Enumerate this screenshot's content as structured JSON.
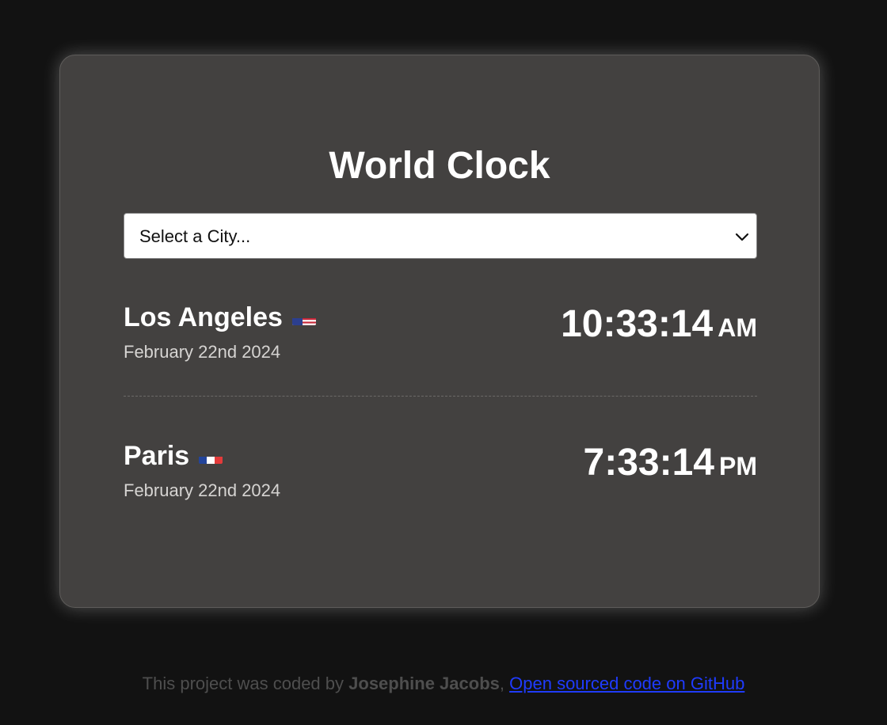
{
  "app": {
    "title": "World Clock"
  },
  "city_select": {
    "selected_label": "Select a City...",
    "icon": "chevron-down-icon"
  },
  "cities": [
    {
      "name": "Los Angeles",
      "flag": "us-flag-icon",
      "date": "February 22nd 2024",
      "time": "10:33:14",
      "period": "AM"
    },
    {
      "name": "Paris",
      "flag": "fr-flag-icon",
      "date": "February 22nd 2024",
      "time": "7:33:14",
      "period": "PM"
    }
  ],
  "footer": {
    "prefix": "This project was coded by",
    "author": "Josephine Jacobs",
    "separator": ",",
    "link_text": "Open sourced code on GitHub"
  },
  "colors": {
    "page_background": "#121212",
    "card_background": "#434140",
    "link": "#1f3bff"
  }
}
